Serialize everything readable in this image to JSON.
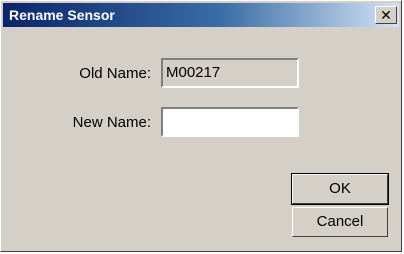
{
  "window": {
    "title": "Rename Sensor",
    "close_glyph": "✕"
  },
  "form": {
    "old_name_label": "Old Name:",
    "old_name_value": "M00217",
    "new_name_label": "New Name:",
    "new_name_value": ""
  },
  "buttons": {
    "ok_label": "OK",
    "cancel_label": "Cancel"
  },
  "colors": {
    "titlebar_start": "#0a246a",
    "titlebar_end": "#d4e3f5",
    "face": "#d4d0c8"
  }
}
